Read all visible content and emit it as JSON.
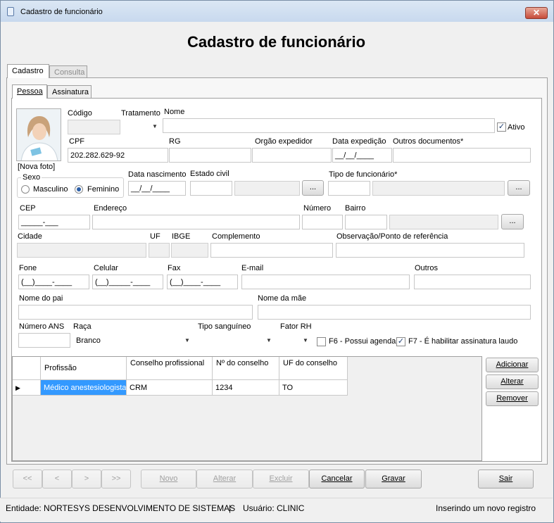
{
  "window": {
    "title": "Cadastro de funcionário",
    "close_glyph": "✕"
  },
  "header": {
    "title": "Cadastro de funcionário"
  },
  "tabs": {
    "cadastro": "Cadastro",
    "consulta": "Consulta"
  },
  "subtabs": {
    "pessoa": "Pessoa",
    "assinatura": "Assinatura"
  },
  "photo": {
    "caption": "[Nova foto]"
  },
  "fields": {
    "codigo": {
      "label": "Código",
      "value": ""
    },
    "tratamento": {
      "label": "Tratamento",
      "value": ""
    },
    "nome": {
      "label": "Nome",
      "value": ""
    },
    "ativo": {
      "label": "Ativo",
      "checked": true
    },
    "cpf": {
      "label": "CPF",
      "value": "202.282.629-92"
    },
    "rg": {
      "label": "RG",
      "value": ""
    },
    "orgao": {
      "label": "Orgão expedidor",
      "value": ""
    },
    "data_expedicao": {
      "label": "Data expedição",
      "value": "__/__/____"
    },
    "outros_documentos": {
      "label": "Outros documentos*",
      "value": ""
    },
    "sexo": {
      "label": "Sexo",
      "masculino": "Masculino",
      "feminino": "Feminino",
      "selected": "Feminino"
    },
    "data_nascimento": {
      "label": "Data nascimento",
      "value": "__/__/____"
    },
    "estado_civil": {
      "label": "Estado civil",
      "value": ""
    },
    "tipo_funcionario": {
      "label": "Tipo de funcionário*",
      "value": ""
    },
    "cep": {
      "label": "CEP",
      "value": "_____-___"
    },
    "endereco": {
      "label": "Endereço",
      "value": ""
    },
    "numero": {
      "label": "Número",
      "value": ""
    },
    "bairro": {
      "label": "Bairro",
      "value": ""
    },
    "cidade": {
      "label": "Cidade",
      "value": ""
    },
    "uf": {
      "label": "UF",
      "value": ""
    },
    "ibge": {
      "label": "IBGE",
      "value": ""
    },
    "complemento": {
      "label": "Complemento",
      "value": ""
    },
    "observacao": {
      "label": "Observação/Ponto de referência",
      "value": ""
    },
    "fone": {
      "label": "Fone",
      "value": "(__)____-____"
    },
    "celular": {
      "label": "Celular",
      "value": "(__)_____-____"
    },
    "fax": {
      "label": "Fax",
      "value": "(__)____-____"
    },
    "email": {
      "label": "E-mail",
      "value": ""
    },
    "outros": {
      "label": "Outros",
      "value": ""
    },
    "nome_pai": {
      "label": "Nome do pai",
      "value": ""
    },
    "nome_mae": {
      "label": "Nome da mãe",
      "value": ""
    },
    "numero_ans": {
      "label": "Número ANS",
      "value": ""
    },
    "raca": {
      "label": "Raça",
      "value": "Branco"
    },
    "tipo_sanguineo": {
      "label": "Tipo sanguíneo",
      "value": ""
    },
    "fator_rh": {
      "label": "Fator RH",
      "value": ""
    },
    "possui_agenda": {
      "label": "F6 - Possui agenda",
      "checked": false
    },
    "habilitar_assinatura": {
      "label": "F7 - É habilitar assinatura laudo",
      "checked": true
    }
  },
  "ellipsis": "...",
  "grid": {
    "columns": [
      "Profissão",
      "Conselho profissional",
      "Nº do conselho",
      "UF do conselho"
    ],
    "rows": [
      [
        "Médico anestesiologista",
        "CRM",
        "1234",
        "TO"
      ]
    ],
    "row_indicator": "▶"
  },
  "grid_buttons": {
    "adicionar": "Adicionar",
    "alterar": "Alterar",
    "remover": "Remover"
  },
  "nav": {
    "first": "<<",
    "prev": "<",
    "next": ">",
    "last": ">>"
  },
  "actions": {
    "novo": "Novo",
    "alterar": "Alterar",
    "excluir": "Excluir",
    "cancelar": "Cancelar",
    "gravar": "Gravar",
    "sair": "Sair"
  },
  "status": {
    "entidade": "Entidade: NORTESYS DESENVOLVIMENTO DE SISTEMAS",
    "separator": "|",
    "usuario": "Usuário: CLINIC",
    "mensagem": "Inserindo um novo registro"
  }
}
